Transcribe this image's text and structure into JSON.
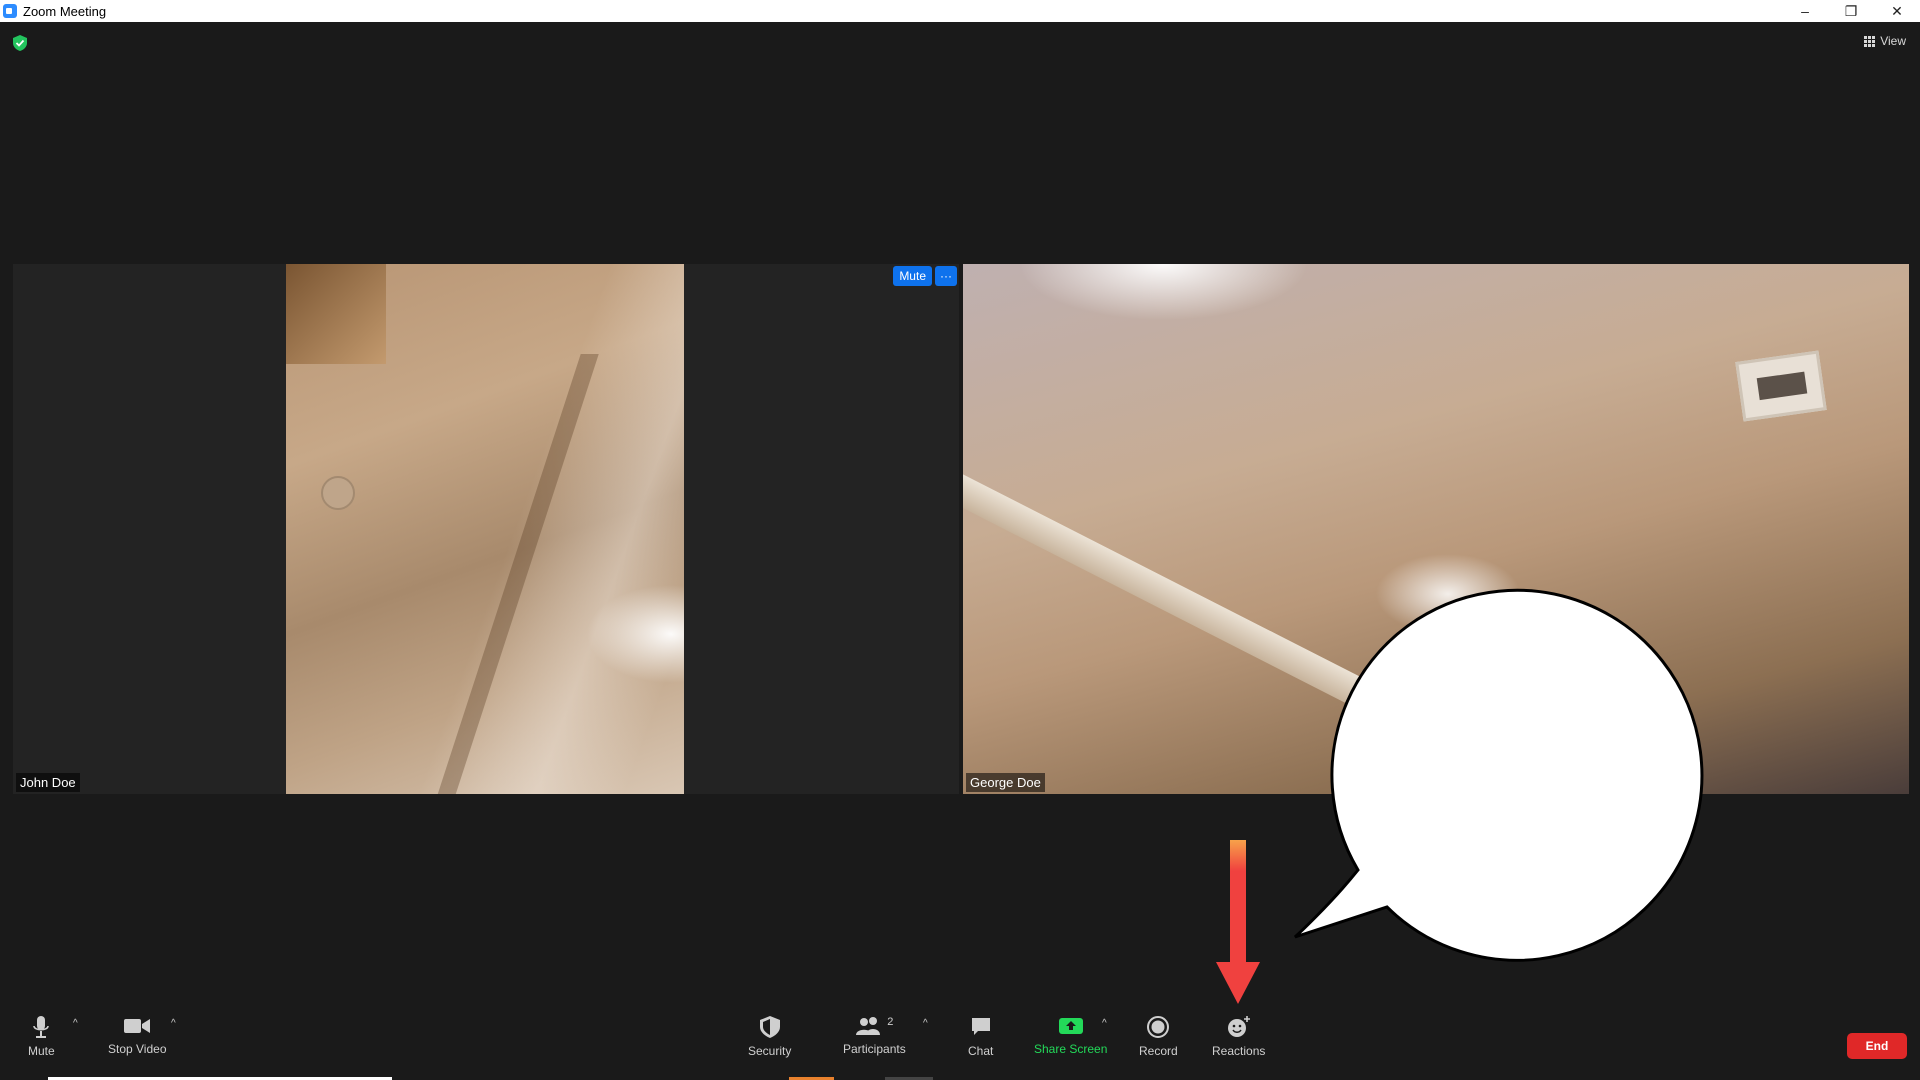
{
  "window": {
    "title": "Zoom Meeting",
    "controls": {
      "minimize": "–",
      "restore": "❐",
      "close": "✕"
    }
  },
  "top_bar": {
    "encryption_icon": "shield-check-icon",
    "view_label": "View"
  },
  "tiles": [
    {
      "participant": "John Doe",
      "mute_label": "Mute",
      "more_label": "···"
    },
    {
      "participant": "George Doe"
    }
  ],
  "toolbar": {
    "mute": "Mute",
    "stop_video": "Stop Video",
    "security": "Security",
    "participants": "Participants",
    "participants_count": "2",
    "chat": "Chat",
    "share_screen": "Share Screen",
    "record": "Record",
    "reactions": "Reactions",
    "end": "End",
    "caret": "^"
  },
  "colors": {
    "accent_blue": "#0e72ed",
    "share_green": "#23d959",
    "end_red": "#e02828",
    "annotation_arrow": "#f0413f"
  }
}
